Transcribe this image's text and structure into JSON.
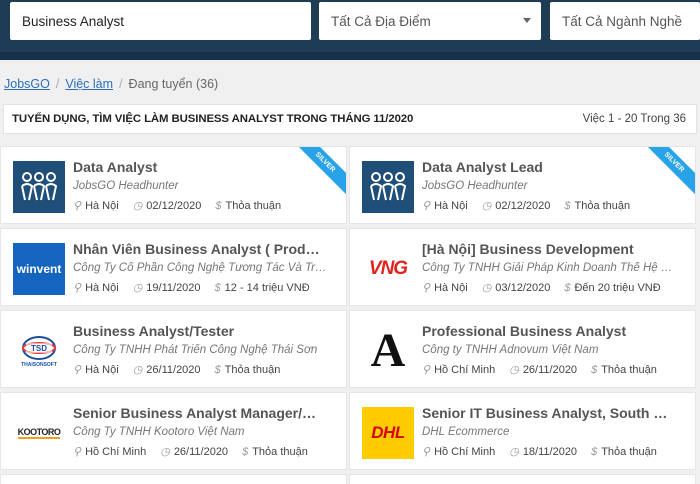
{
  "search": {
    "keyword": "Business Analyst",
    "location": "Tất Cả Địa Điểm",
    "industry": "Tất Cả Ngành Nghề"
  },
  "breadcrumb": {
    "home": "JobsGO",
    "jobs": "Việc làm",
    "current": "Đang tuyển (36)"
  },
  "header": {
    "title": "TUYỂN DỤNG, TÌM VIỆC LÀM BUSINESS ANALYST TRONG THÁNG 11/2020",
    "count": "Việc 1 - 20 Trong 36"
  },
  "colors": {
    "topbar": "#1e3d55",
    "ribbon": "#29a3e8",
    "jobsgo_logo": "#1f4e79",
    "dhl_yellow": "#ffcc00",
    "dhl_red": "#d40511"
  },
  "jobs": [
    {
      "title": "Data Analyst",
      "company": "JobsGO Headhunter",
      "location": "Hà Nội",
      "date": "02/12/2020",
      "salary": "Thỏa thuận",
      "badge": "SILVER",
      "logo": "jobsgo-logo"
    },
    {
      "title": "Data Analyst Lead",
      "company": "JobsGO Headhunter",
      "location": "Hà Nội",
      "date": "02/12/2020",
      "salary": "Thỏa thuận",
      "badge": "SILVER",
      "logo": "jobsgo-logo"
    },
    {
      "title": "Nhân Viên Business Analyst ( Product Owner )",
      "company": "Công Ty Cổ Phần Công Nghệ Tương Tác Và Truyền Thông Winvent",
      "location": "Hà Nội",
      "date": "19/11/2020",
      "salary": "12 - 14 triệu VNĐ",
      "logo": "winvent-logo",
      "logo_text": "winvent"
    },
    {
      "title": "[Hà Nội] Business Development",
      "company": "Công Ty TNHH Giải Pháp Kinh Doanh Thế Hệ Mới VNG",
      "location": "Hà Nội",
      "date": "03/12/2020",
      "salary": "Đến 20 triệu VNĐ",
      "logo": "vng-logo",
      "logo_text": "VNG"
    },
    {
      "title": "Business Analyst/Tester",
      "company": "Công Ty TNHH Phát Triển Công Nghệ Thái Sơn",
      "location": "Hà Nội",
      "date": "26/11/2020",
      "salary": "Thỏa thuận",
      "logo": "thaisonsoft-logo",
      "logo_text": "THAISONSOFT"
    },
    {
      "title": "Professional Business Analyst",
      "company": "Công ty TNHH Adnovum Việt Nam",
      "location": "Hồ Chí Minh",
      "date": "26/11/2020",
      "salary": "Thỏa thuận",
      "logo": "adnovum-logo",
      "logo_text": "A"
    },
    {
      "title": "Senior Business Analyst Manager/Director",
      "company": "Công Ty TNHH Kootoro Việt Nam",
      "location": "Hồ Chí Minh",
      "date": "26/11/2020",
      "salary": "Thỏa thuận",
      "logo": "kootoro-logo",
      "logo_text": "KOOTORO"
    },
    {
      "title": "Senior IT Business Analyst, South East Asia",
      "company": "DHL Ecommerce",
      "location": "Hồ Chí Minh",
      "date": "18/11/2020",
      "salary": "Thỏa thuận",
      "logo": "dhl-logo",
      "logo_text": "DHL"
    }
  ]
}
